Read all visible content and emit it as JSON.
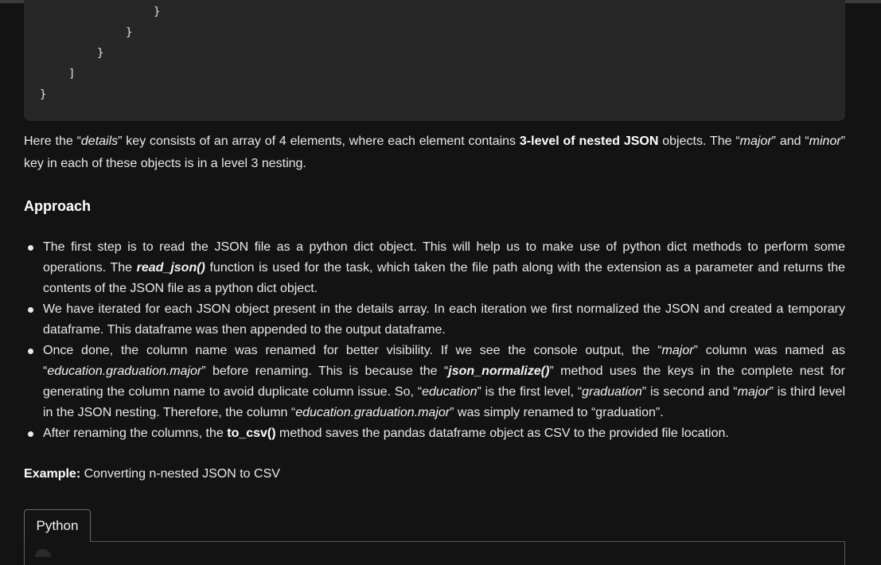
{
  "code": {
    "lines": [
      "}",
      "}",
      "}",
      "]",
      "}"
    ]
  },
  "intro": {
    "p1": "Here the “",
    "details": "details",
    "p2": "” key consists of an array of 4 elements, where each element contains ",
    "bold": "3-level of nested JSON",
    "p3": " objects. The “",
    "major": "major",
    "p4": "” and “",
    "minor": "minor",
    "p5": "” key in each of these objects is in a level 3 nesting."
  },
  "approach": {
    "heading": "Approach",
    "b1": {
      "t1": "The first step is to read the JSON file as a python dict object. This will help us to make use of python dict methods to perform some operations. The ",
      "fn": "read_json()",
      "t2": " function is used for the task, which taken the file path along with the extension as a parameter and returns the contents of the JSON file as a python dict object."
    },
    "b2": {
      "t1": "We have iterated for each JSON object present in the details array. In each iteration we first normalized the JSON and created a temporary dataframe. This dataframe was then appended to the output dataframe."
    },
    "b3": {
      "t1": "Once done, the column name was renamed for better visibility. If we see the console output, the “",
      "i1": "major",
      "t2": "” column was named as “",
      "i2": "education.graduation.major",
      "t3": "” before renaming. This is because the “",
      "fn": "json_normalize()",
      "t4": "” method uses the keys in the complete nest for generating the column name to avoid duplicate column issue. So, “",
      "i3": "education",
      "t5": "” is the first level, “",
      "i4": "graduation",
      "t6": "” is second and “",
      "i5": "major",
      "t7": "” is third level in the JSON nesting. Therefore, the column “",
      "i6": "education.graduation.major",
      "t8": "” was simply renamed to “graduation”."
    },
    "b4": {
      "t1": "After renaming the columns, the ",
      "fn": "to_csv()",
      "t2": " method saves the pandas dataframe object as CSV to the provided file location."
    }
  },
  "example": {
    "label": "Example:",
    "text": " Converting n-nested JSON to CSV"
  },
  "tabs": {
    "python": "Python"
  }
}
